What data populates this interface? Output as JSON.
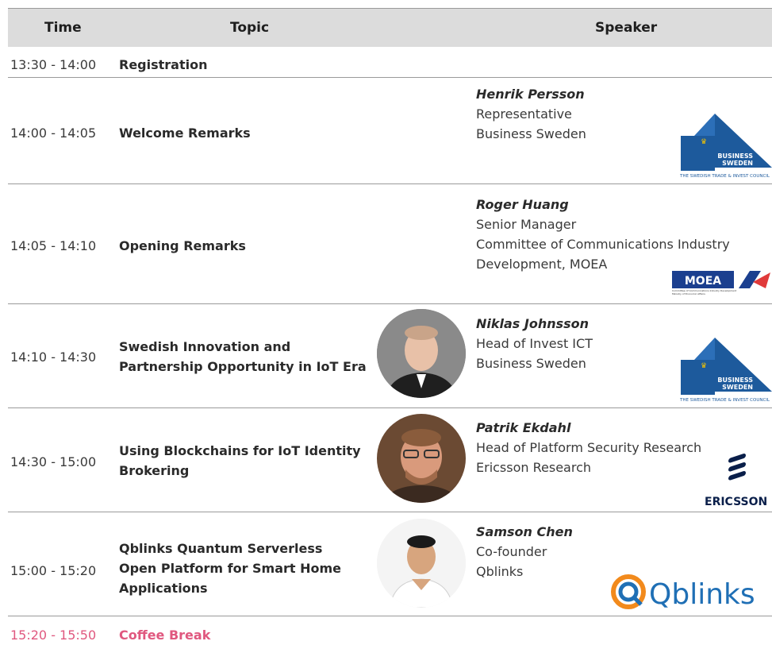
{
  "headers": {
    "time": "Time",
    "topic": "Topic",
    "speaker": "Speaker"
  },
  "rows": [
    {
      "time": "13:30 - 14:00",
      "topic": "Registration"
    },
    {
      "time": "14:00 - 14:05",
      "topic": "Welcome Remarks",
      "speaker": {
        "name": "Henrik Persson",
        "title": "Representative",
        "org": "Business Sweden"
      }
    },
    {
      "time": "14:05 - 14:10",
      "topic": "Opening Remarks",
      "speaker": {
        "name": "Roger Huang",
        "title": "Senior Manager",
        "org": "Committee of Communications Industry",
        "org2": "Development, MOEA"
      }
    },
    {
      "time": "14:10 - 14:30",
      "topic1": "Swedish Innovation and",
      "topic2": "Partnership Opportunity in IoT Era",
      "speaker": {
        "name": "Niklas Johnsson",
        "title": "Head of Invest ICT",
        "org": "Business Sweden"
      }
    },
    {
      "time": "14:30 - 15:00",
      "topic1": "Using Blockchains for IoT Identity",
      "topic2": "Brokering",
      "speaker": {
        "name": "Patrik Ekdahl",
        "title": "Head of Platform Security Research",
        "org": "Ericsson Research"
      }
    },
    {
      "time": "15:00 - 15:20",
      "topic1": "Qblinks Quantum Serverless",
      "topic2": "Open Platform for Smart Home",
      "topic3": "Applications",
      "speaker": {
        "name": "Samson Chen",
        "title": "Co-founder",
        "org": "Qblinks"
      }
    },
    {
      "time": "15:20 - 15:50",
      "topic": "Coffee Break"
    }
  ],
  "logos": {
    "business_sweden": {
      "text1": "BUSINESS",
      "text2": "SWEDEN",
      "tagline": "THE SWEDISH TRADE & INVEST COUNCIL"
    },
    "moea": {
      "text": "MOEA",
      "tagline1": "Committee of Communications Industry Development",
      "tagline2": "Ministry of Economic Affairs"
    },
    "ericsson": {
      "text": "ERICSSON"
    },
    "qblinks": {
      "text": "Qblinks"
    }
  },
  "colors": {
    "header_bg": "#dcdcdc",
    "coffee": "#e0587f",
    "sweden_blue": "#1d5a9c",
    "qblinks_orange": "#f28a1c",
    "qblinks_blue": "#1f6fb5"
  }
}
